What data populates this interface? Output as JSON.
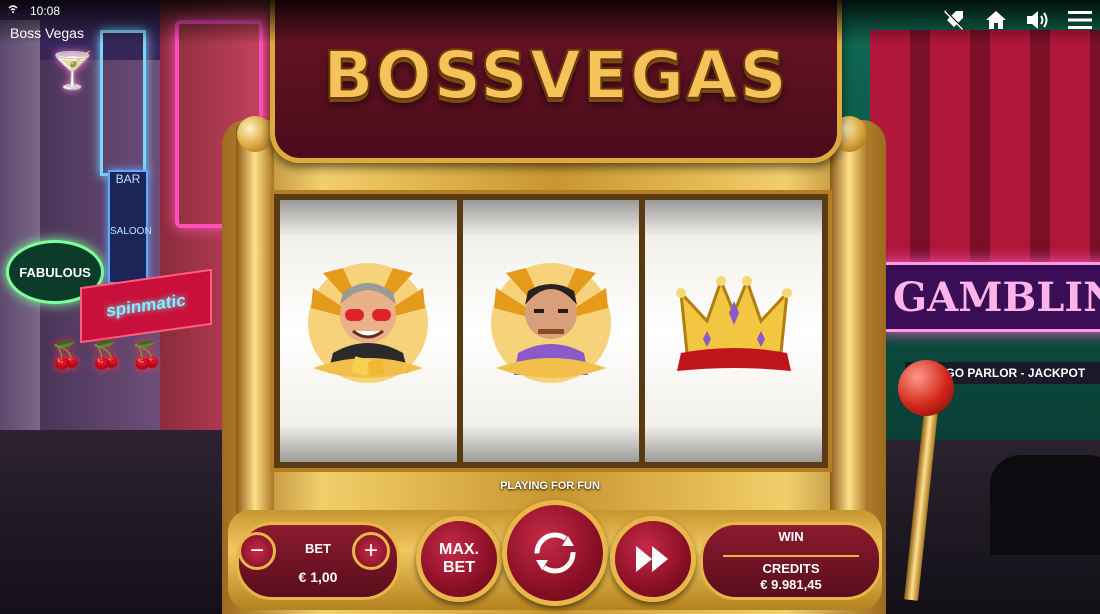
{
  "status_bar": {
    "time": "10:08",
    "wifi_icon": "wifi-icon"
  },
  "app": {
    "title": "Boss Vegas"
  },
  "toolbar": {
    "icons": [
      "rocket-off-icon",
      "home-icon",
      "volume-icon",
      "menu-icon"
    ]
  },
  "game": {
    "logo": "BOSSVEGAS",
    "reels": [
      {
        "symbol": "boss-with-sunglasses-and-dice",
        "name": "reel-1"
      },
      {
        "symbol": "mobster-with-cigar",
        "name": "reel-2"
      },
      {
        "symbol": "golden-crown",
        "name": "reel-3"
      }
    ],
    "mode_text": "PLAYING FOR FUN"
  },
  "bet": {
    "label": "BET",
    "value": "€ 1,00",
    "minus": "−",
    "plus": "+"
  },
  "max_bet": {
    "line1": "MAX.",
    "line2": "BET"
  },
  "win": {
    "label": "WIN",
    "credits_label": "CREDITS",
    "credits_value": "€ 9.981,45"
  },
  "scenery": {
    "signs": [
      "FABULOUS",
      "BAR",
      "SALOON",
      "spinmatic",
      "GAMBLIN",
      "BINGO PARLOR - JACKPOT"
    ]
  },
  "colors": {
    "gold": "#e9b64a",
    "maroon": "#6a1426",
    "button_red": "#c62b48"
  }
}
